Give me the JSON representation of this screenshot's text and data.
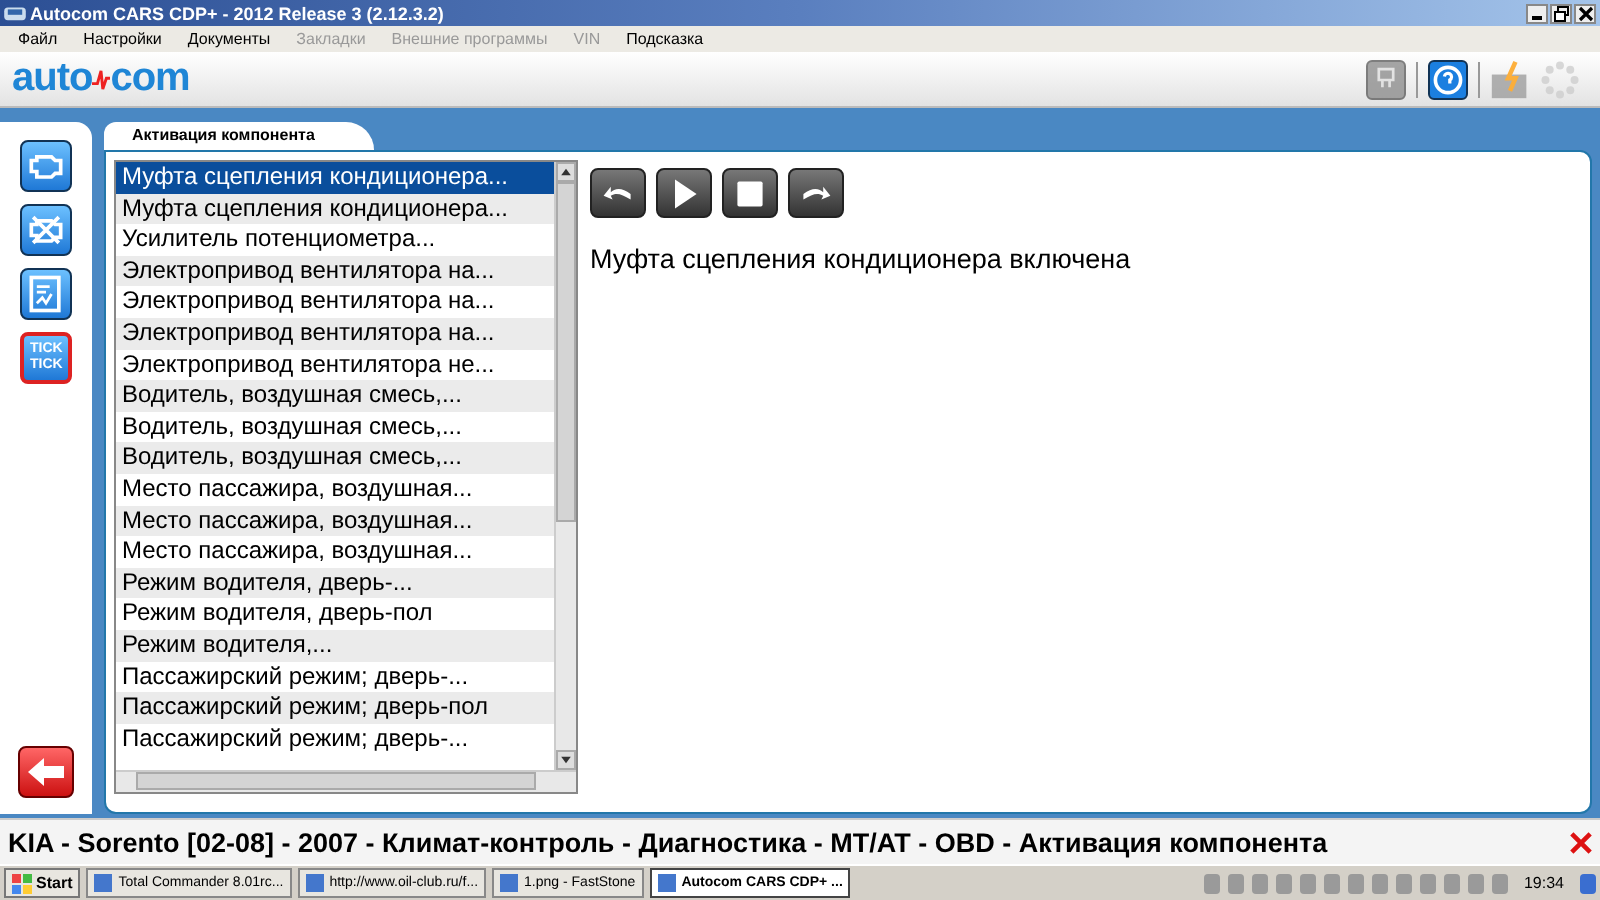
{
  "window": {
    "title": "Autocom CARS CDP+ - 2012 Release 3 (2.12.3.2)"
  },
  "menu": [
    {
      "label": "Файл",
      "disabled": false
    },
    {
      "label": "Настройки",
      "disabled": false
    },
    {
      "label": "Документы",
      "disabled": false
    },
    {
      "label": "Закладки",
      "disabled": true
    },
    {
      "label": "Внешние программы",
      "disabled": true
    },
    {
      "label": "VIN",
      "disabled": true
    },
    {
      "label": "Подсказка",
      "disabled": false
    }
  ],
  "logo": {
    "left": "auto",
    "right": "com"
  },
  "toolbar": [
    {
      "kind": "obd",
      "disabled": true
    },
    {
      "kind": "help",
      "disabled": false
    },
    {
      "kind": "battery",
      "disabled": true
    },
    {
      "kind": "spinner",
      "disabled": true
    }
  ],
  "sidebar": {
    "items": [
      {
        "kind": "engine",
        "selected": false
      },
      {
        "kind": "engine-off",
        "selected": false
      },
      {
        "kind": "graph",
        "selected": false
      },
      {
        "kind": "tick",
        "label": "TICK TICK",
        "selected": true
      }
    ]
  },
  "tab": {
    "label": "Активация компонента"
  },
  "components": [
    {
      "label": "Муфта сцепления кондиционера...",
      "selected": true
    },
    {
      "label": "Муфта сцепления кондиционера...",
      "selected": false
    },
    {
      "label": "Усилитель потенциометра...",
      "selected": false
    },
    {
      "label": "Электропривод вентилятора на...",
      "selected": false
    },
    {
      "label": "Электропривод вентилятора на...",
      "selected": false
    },
    {
      "label": "Электропривод вентилятора на...",
      "selected": false
    },
    {
      "label": "Электропривод вентилятора не...",
      "selected": false
    },
    {
      "label": "Водитель, воздушная смесь,...",
      "selected": false
    },
    {
      "label": "Водитель, воздушная смесь,...",
      "selected": false
    },
    {
      "label": "Водитель, воздушная смесь,...",
      "selected": false
    },
    {
      "label": "Место пассажира, воздушная...",
      "selected": false
    },
    {
      "label": "Место пассажира, воздушная...",
      "selected": false
    },
    {
      "label": "Место пассажира, воздушная...",
      "selected": false
    },
    {
      "label": "Режим водителя, дверь-...",
      "selected": false
    },
    {
      "label": "Режим водителя, дверь-пол",
      "selected": false
    },
    {
      "label": "Режим водителя,...",
      "selected": false
    },
    {
      "label": "Пассажирский режим; дверь-...",
      "selected": false
    },
    {
      "label": "Пассажирский режим; дверь-пол",
      "selected": false
    },
    {
      "label": "Пассажирский режим; дверь-...",
      "selected": false
    }
  ],
  "controls": [
    {
      "kind": "prev"
    },
    {
      "kind": "play"
    },
    {
      "kind": "stop"
    },
    {
      "kind": "next"
    }
  ],
  "message": "Муфта сцепления кондиционера включена",
  "status_bar": {
    "path": "KIA - Sorento [02-08] - 2007 - Климат-контроль - Диагностика - MT/AT - OBD - Активация компонента"
  },
  "taskbar": {
    "start": "Start",
    "tasks": [
      {
        "label": "Total Commander 8.01rc...",
        "selected": false
      },
      {
        "label": "http://www.oil-club.ru/f...",
        "selected": false
      },
      {
        "label": "1.png - FastStone",
        "selected": false
      },
      {
        "label": "Autocom CARS CDP+ ...",
        "selected": true
      }
    ],
    "clock": "19:34"
  }
}
